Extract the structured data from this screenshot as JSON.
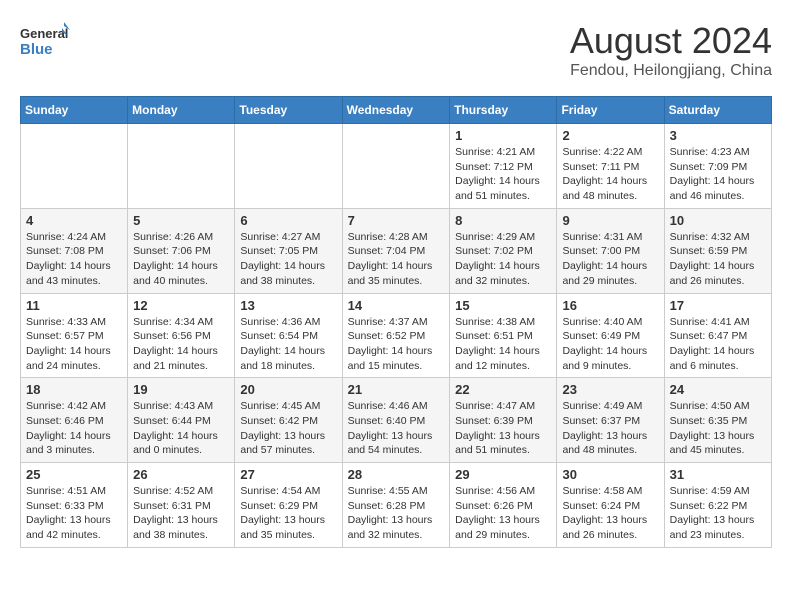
{
  "logo": {
    "line1": "General",
    "line2": "Blue"
  },
  "title": "August 2024",
  "subtitle": "Fendou, Heilongjiang, China",
  "weekdays": [
    "Sunday",
    "Monday",
    "Tuesday",
    "Wednesday",
    "Thursday",
    "Friday",
    "Saturday"
  ],
  "weeks": [
    [
      {
        "day": "",
        "info": ""
      },
      {
        "day": "",
        "info": ""
      },
      {
        "day": "",
        "info": ""
      },
      {
        "day": "",
        "info": ""
      },
      {
        "day": "1",
        "info": "Sunrise: 4:21 AM\nSunset: 7:12 PM\nDaylight: 14 hours\nand 51 minutes."
      },
      {
        "day": "2",
        "info": "Sunrise: 4:22 AM\nSunset: 7:11 PM\nDaylight: 14 hours\nand 48 minutes."
      },
      {
        "day": "3",
        "info": "Sunrise: 4:23 AM\nSunset: 7:09 PM\nDaylight: 14 hours\nand 46 minutes."
      }
    ],
    [
      {
        "day": "4",
        "info": "Sunrise: 4:24 AM\nSunset: 7:08 PM\nDaylight: 14 hours\nand 43 minutes."
      },
      {
        "day": "5",
        "info": "Sunrise: 4:26 AM\nSunset: 7:06 PM\nDaylight: 14 hours\nand 40 minutes."
      },
      {
        "day": "6",
        "info": "Sunrise: 4:27 AM\nSunset: 7:05 PM\nDaylight: 14 hours\nand 38 minutes."
      },
      {
        "day": "7",
        "info": "Sunrise: 4:28 AM\nSunset: 7:04 PM\nDaylight: 14 hours\nand 35 minutes."
      },
      {
        "day": "8",
        "info": "Sunrise: 4:29 AM\nSunset: 7:02 PM\nDaylight: 14 hours\nand 32 minutes."
      },
      {
        "day": "9",
        "info": "Sunrise: 4:31 AM\nSunset: 7:00 PM\nDaylight: 14 hours\nand 29 minutes."
      },
      {
        "day": "10",
        "info": "Sunrise: 4:32 AM\nSunset: 6:59 PM\nDaylight: 14 hours\nand 26 minutes."
      }
    ],
    [
      {
        "day": "11",
        "info": "Sunrise: 4:33 AM\nSunset: 6:57 PM\nDaylight: 14 hours\nand 24 minutes."
      },
      {
        "day": "12",
        "info": "Sunrise: 4:34 AM\nSunset: 6:56 PM\nDaylight: 14 hours\nand 21 minutes."
      },
      {
        "day": "13",
        "info": "Sunrise: 4:36 AM\nSunset: 6:54 PM\nDaylight: 14 hours\nand 18 minutes."
      },
      {
        "day": "14",
        "info": "Sunrise: 4:37 AM\nSunset: 6:52 PM\nDaylight: 14 hours\nand 15 minutes."
      },
      {
        "day": "15",
        "info": "Sunrise: 4:38 AM\nSunset: 6:51 PM\nDaylight: 14 hours\nand 12 minutes."
      },
      {
        "day": "16",
        "info": "Sunrise: 4:40 AM\nSunset: 6:49 PM\nDaylight: 14 hours\nand 9 minutes."
      },
      {
        "day": "17",
        "info": "Sunrise: 4:41 AM\nSunset: 6:47 PM\nDaylight: 14 hours\nand 6 minutes."
      }
    ],
    [
      {
        "day": "18",
        "info": "Sunrise: 4:42 AM\nSunset: 6:46 PM\nDaylight: 14 hours\nand 3 minutes."
      },
      {
        "day": "19",
        "info": "Sunrise: 4:43 AM\nSunset: 6:44 PM\nDaylight: 14 hours\nand 0 minutes."
      },
      {
        "day": "20",
        "info": "Sunrise: 4:45 AM\nSunset: 6:42 PM\nDaylight: 13 hours\nand 57 minutes."
      },
      {
        "day": "21",
        "info": "Sunrise: 4:46 AM\nSunset: 6:40 PM\nDaylight: 13 hours\nand 54 minutes."
      },
      {
        "day": "22",
        "info": "Sunrise: 4:47 AM\nSunset: 6:39 PM\nDaylight: 13 hours\nand 51 minutes."
      },
      {
        "day": "23",
        "info": "Sunrise: 4:49 AM\nSunset: 6:37 PM\nDaylight: 13 hours\nand 48 minutes."
      },
      {
        "day": "24",
        "info": "Sunrise: 4:50 AM\nSunset: 6:35 PM\nDaylight: 13 hours\nand 45 minutes."
      }
    ],
    [
      {
        "day": "25",
        "info": "Sunrise: 4:51 AM\nSunset: 6:33 PM\nDaylight: 13 hours\nand 42 minutes."
      },
      {
        "day": "26",
        "info": "Sunrise: 4:52 AM\nSunset: 6:31 PM\nDaylight: 13 hours\nand 38 minutes."
      },
      {
        "day": "27",
        "info": "Sunrise: 4:54 AM\nSunset: 6:29 PM\nDaylight: 13 hours\nand 35 minutes."
      },
      {
        "day": "28",
        "info": "Sunrise: 4:55 AM\nSunset: 6:28 PM\nDaylight: 13 hours\nand 32 minutes."
      },
      {
        "day": "29",
        "info": "Sunrise: 4:56 AM\nSunset: 6:26 PM\nDaylight: 13 hours\nand 29 minutes."
      },
      {
        "day": "30",
        "info": "Sunrise: 4:58 AM\nSunset: 6:24 PM\nDaylight: 13 hours\nand 26 minutes."
      },
      {
        "day": "31",
        "info": "Sunrise: 4:59 AM\nSunset: 6:22 PM\nDaylight: 13 hours\nand 23 minutes."
      }
    ]
  ]
}
